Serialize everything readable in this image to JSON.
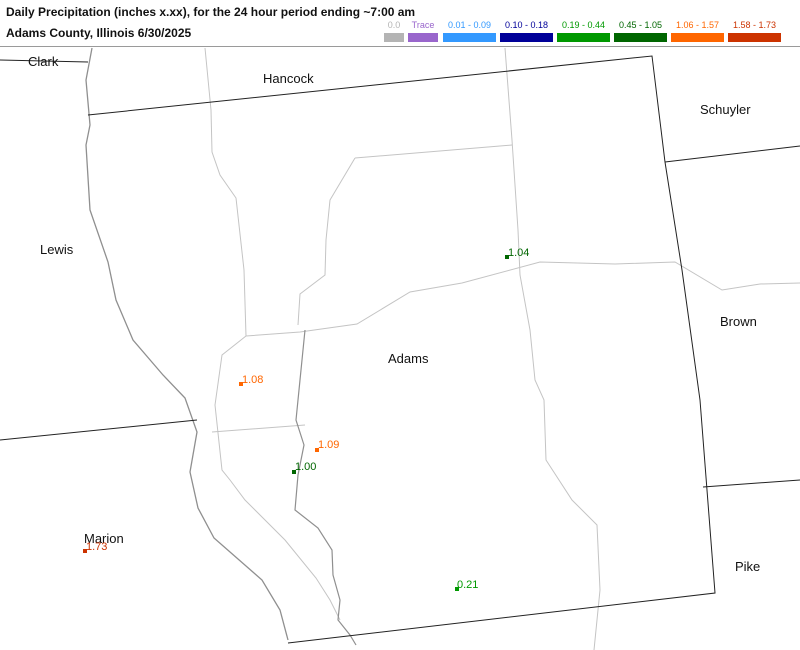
{
  "header": {
    "title": "Daily Precipitation (inches  x.xx),  for the 24 hour period ending ~7:00 am",
    "subtitle": "Adams County, Illinois  6/30/2025"
  },
  "legend": [
    {
      "label": "0.0",
      "color": "#b4b4b4"
    },
    {
      "label": "Trace",
      "color": "#9966cc"
    },
    {
      "label": "0.01 - 0.09",
      "color": "#3399ff"
    },
    {
      "label": "0.10 - 0.18",
      "color": "#000099"
    },
    {
      "label": "0.19 - 0.44",
      "color": "#009900"
    },
    {
      "label": "0.45 - 1.05",
      "color": "#006600"
    },
    {
      "label": "1.06 - 1.57",
      "color": "#ff6600"
    },
    {
      "label": "1.58 - 1.73",
      "color": "#cc3300"
    }
  ],
  "counties": {
    "clark": "Clark",
    "hancock": "Hancock",
    "schuyler": "Schuyler",
    "lewis": "Lewis",
    "brown": "Brown",
    "adams": "Adams",
    "marion": "Marion",
    "pike": "Pike"
  },
  "stations": [
    {
      "value": "1.04",
      "color": "#006600"
    },
    {
      "value": "1.08",
      "color": "#ff6600"
    },
    {
      "value": "1.09",
      "color": "#ff6600"
    },
    {
      "value": "1.00",
      "color": "#006600"
    },
    {
      "value": "1.73",
      "color": "#cc3300"
    },
    {
      "value": "0.21",
      "color": "#009900"
    }
  ]
}
